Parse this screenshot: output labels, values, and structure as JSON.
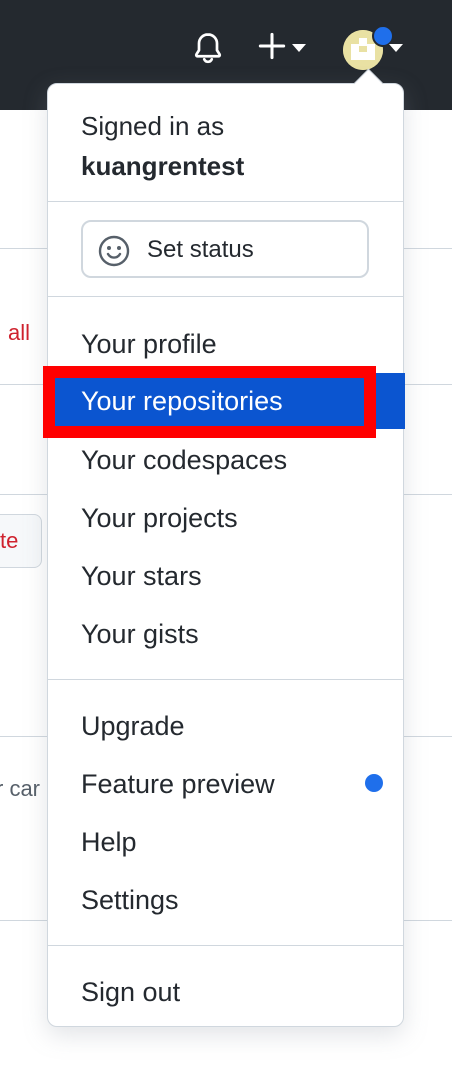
{
  "header": {
    "notifications_icon": "bell-icon",
    "create_icon": "plus-icon",
    "avatar_icon": "avatar-image"
  },
  "background": {
    "text_all": "all",
    "text_te": "te",
    "text_car": "r car"
  },
  "dropdown": {
    "signed_in_prefix": "Signed in as",
    "username": "kuangrentest",
    "set_status_label": "Set status",
    "items_group1": [
      "Your profile",
      "Your repositories",
      "Your codespaces",
      "Your projects",
      "Your stars",
      "Your gists"
    ],
    "items_group2": [
      "Upgrade",
      "Feature preview",
      "Help",
      "Settings"
    ],
    "sign_out_label": "Sign out",
    "active_item": "Your repositories"
  },
  "colors": {
    "header_bg": "#24292f",
    "active_bg": "#0b55d0",
    "accent_blue": "#1f6feb",
    "highlight_red": "#ff0000",
    "danger_text": "#cf222e"
  }
}
